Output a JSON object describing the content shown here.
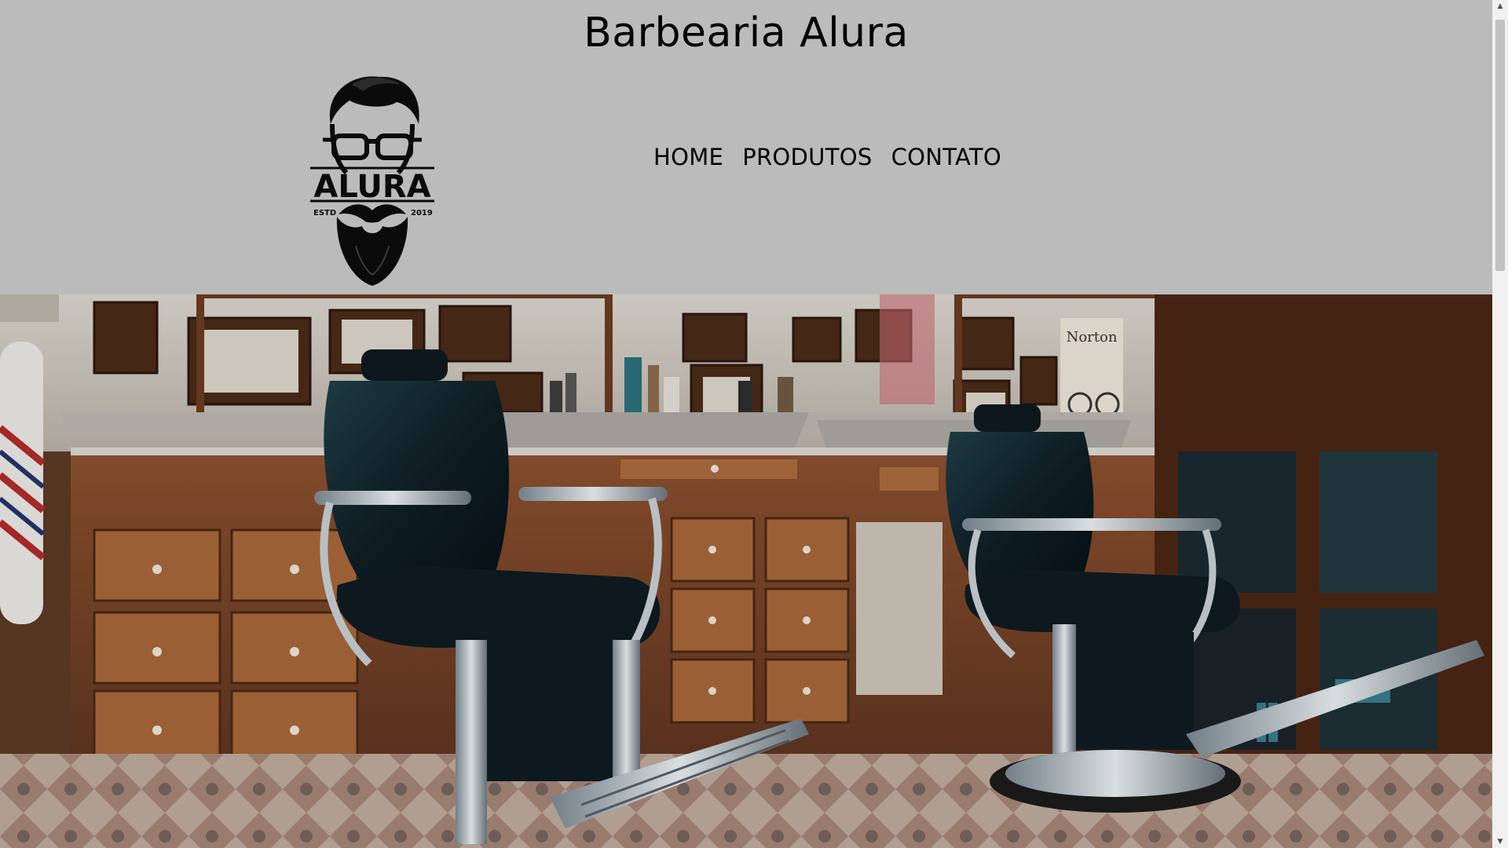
{
  "header": {
    "title": "Barbearia Alura",
    "logo": {
      "icon": "bearded-man-glasses-logo",
      "wordmark": "ALURA",
      "left_text": "ESTD",
      "right_text": "2019"
    }
  },
  "nav": {
    "items": [
      {
        "label": "HOME"
      },
      {
        "label": "PRODUTOS"
      },
      {
        "label": "CONTATO"
      }
    ]
  },
  "hero": {
    "image": "barbershop-interior-photo",
    "wall_poster_text": "Norton"
  },
  "colors": {
    "header_background": "#bbbbbb",
    "text": "#000000"
  }
}
